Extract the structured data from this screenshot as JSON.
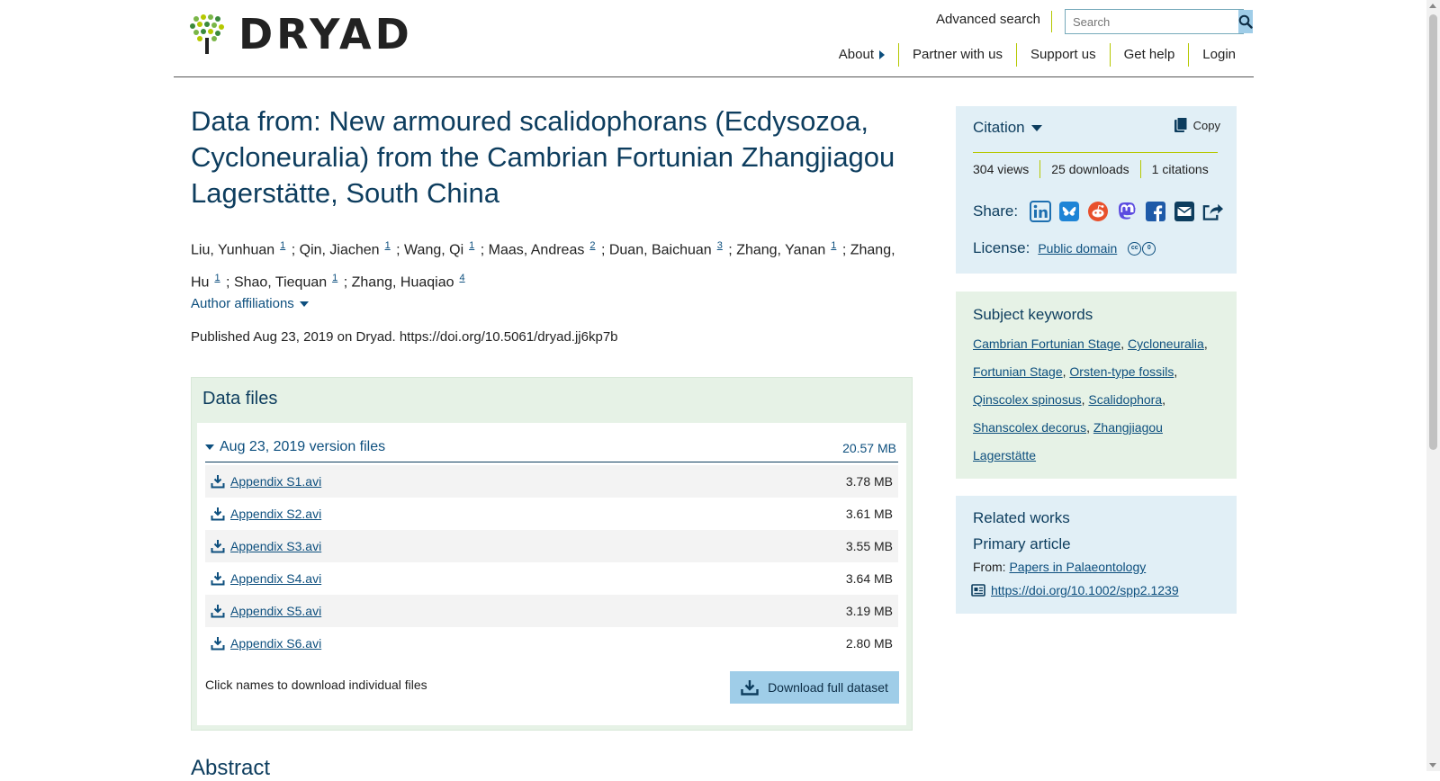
{
  "header": {
    "logo_text": "DRYAD",
    "advanced_search": "Advanced search",
    "search_placeholder": "Search",
    "nav": {
      "about": "About",
      "partner": "Partner with us",
      "support": "Support us",
      "help": "Get help",
      "login": "Login"
    }
  },
  "dataset": {
    "title": "Data from: New armoured scalidophorans (Ecdysozoa, Cycloneuralia) from the Cambrian Fortunian Zhangjiagou Lagerstätte, South China",
    "authors": [
      {
        "name": "Liu, Yunhuan",
        "aff": "1"
      },
      {
        "name": "Qin, Jiachen",
        "aff": "1"
      },
      {
        "name": "Wang, Qi",
        "aff": "1"
      },
      {
        "name": "Maas, Andreas",
        "aff": "2"
      },
      {
        "name": "Duan, Baichuan",
        "aff": "3"
      },
      {
        "name": "Zhang, Yanan",
        "aff": "1"
      },
      {
        "name": "Zhang, Hu",
        "aff": "1"
      },
      {
        "name": "Shao, Tiequan",
        "aff": "1"
      },
      {
        "name": "Zhang, Huaqiao",
        "aff": "4"
      }
    ],
    "author_sep": ";",
    "affiliations_toggle": "Author affiliations",
    "published": "Published Aug 23, 2019 on Dryad. https://doi.org/10.5061/dryad.jj6kp7b"
  },
  "data_files": {
    "heading": "Data files",
    "version_label": "Aug 23, 2019 version files",
    "version_size": "20.57 MB",
    "files": [
      {
        "name": "Appendix S1.avi",
        "size": "3.78 MB"
      },
      {
        "name": "Appendix S2.avi",
        "size": "3.61 MB"
      },
      {
        "name": "Appendix S3.avi",
        "size": "3.55 MB"
      },
      {
        "name": "Appendix S4.avi",
        "size": "3.64 MB"
      },
      {
        "name": "Appendix S5.avi",
        "size": "3.19 MB"
      },
      {
        "name": "Appendix S6.avi",
        "size": "2.80 MB"
      }
    ],
    "hint": "Click names to download individual files",
    "download_button": "Download full dataset"
  },
  "abstract_heading": "Abstract",
  "sidebar": {
    "citation": {
      "heading": "Citation",
      "copy": "Copy",
      "views": "304 views",
      "downloads": "25 downloads",
      "citations": "1 citations",
      "share_label": "Share:",
      "share_icons": [
        "linkedin-icon",
        "bluesky-icon",
        "reddit-icon",
        "mastodon-icon",
        "facebook-icon",
        "email-icon",
        "share-icon"
      ],
      "license_label": "License:",
      "license_value": "Public domain"
    },
    "keywords": {
      "heading": "Subject keywords",
      "items": [
        "Cambrian Fortunian Stage",
        "Cycloneuralia",
        "Fortunian Stage",
        "Orsten-type fossils",
        "Qinscolex spinosus",
        "Scalidophora",
        "Shanscolex decorus",
        "Zhangjiagou Lagerstätte"
      ]
    },
    "related": {
      "heading": "Related works",
      "subheading": "Primary article",
      "from_label": "From:",
      "from_link": "Papers in Palaeontology",
      "doi": "https://doi.org/10.1002/spp2.1239"
    }
  },
  "colors": {
    "brand_dark": "#0d3d5e",
    "link": "#0d4f7e",
    "accent_green": "#b5c800",
    "panel_blue": "#e1eff6",
    "panel_green": "#e6f2e6",
    "button_blue": "#9fcde8"
  }
}
